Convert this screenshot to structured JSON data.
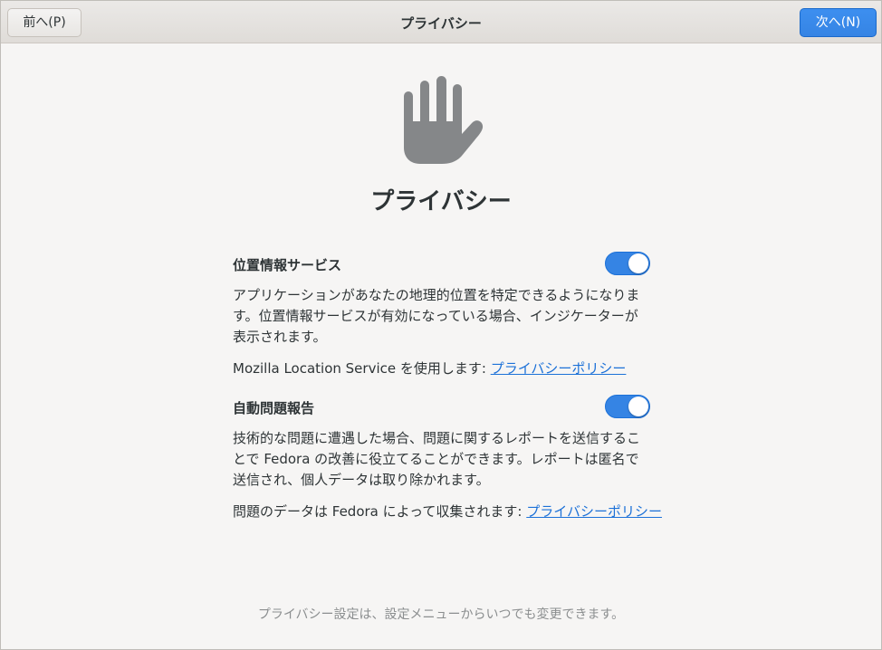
{
  "header": {
    "title": "プライバシー",
    "back_label": "前へ(P)",
    "next_label": "次へ(N)"
  },
  "page": {
    "icon": "hand-stop-icon",
    "title": "プライバシー"
  },
  "location": {
    "title": "位置情報サービス",
    "enabled": true,
    "description": "アプリケーションがあなたの地理的位置を特定できるようになります。位置情報サービスが有効になっている場合、インジケーターが表示されます。",
    "policy_prefix": "Mozilla Location Service を使用します: ",
    "policy_link": "プライバシーポリシー"
  },
  "problem_report": {
    "title": "自動問題報告",
    "enabled": true,
    "description": "技術的な問題に遭遇した場合、問題に関するレポートを送信することで Fedora の改善に役立てることができます。レポートは匿名で送信され、個人データは取り除かれます。",
    "policy_prefix": "問題のデータは Fedora によって収集されます: ",
    "policy_link": "プライバシーポリシー"
  },
  "footer": {
    "note": "プライバシー設定は、設定メニューからいつでも変更できます。"
  },
  "colors": {
    "accent": "#3584e4",
    "link": "#1c71d8",
    "icon": "#858789"
  }
}
